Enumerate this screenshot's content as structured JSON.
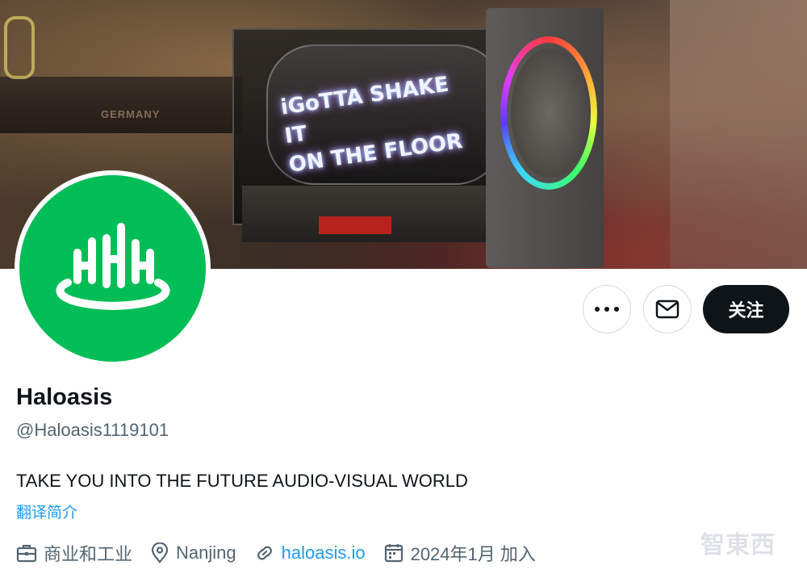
{
  "banner": {
    "holo_text": "iGoTTA SHAKE IT\nON THE FLOOR",
    "shelf_text": "GERMANY"
  },
  "profile": {
    "display_name": "Haloasis",
    "handle": "@Haloasis1119101",
    "bio": "TAKE YOU INTO THE FUTURE AUDIO-VISUAL WORLD",
    "translate_label": "翻译简介",
    "avatar_color": "#00bd55"
  },
  "actions": {
    "more_icon": "more-dots-icon",
    "mail_icon": "mail-icon",
    "follow_label": "关注"
  },
  "meta": {
    "category": "商业和工业",
    "location": "Nanjing",
    "website": "haloasis.io",
    "joined": "2024年1月 加入"
  },
  "watermark": "智東西",
  "colors": {
    "link": "#1d9bf0",
    "secondary_text": "#536471",
    "primary_text": "#0f1419",
    "follow_bg": "#0f1419"
  }
}
